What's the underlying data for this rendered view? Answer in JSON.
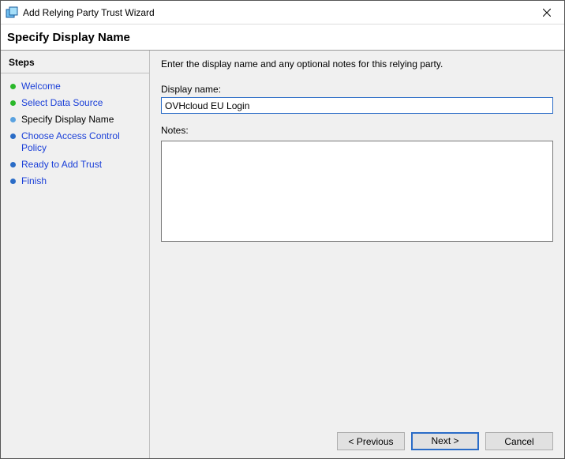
{
  "window": {
    "title": "Add Relying Party Trust Wizard"
  },
  "header": {
    "page_title": "Specify Display Name"
  },
  "sidebar": {
    "steps_header": "Steps",
    "items": [
      {
        "label": "Welcome",
        "state": "done"
      },
      {
        "label": "Select Data Source",
        "state": "done"
      },
      {
        "label": "Specify Display Name",
        "state": "current"
      },
      {
        "label": "Choose Access Control Policy",
        "state": "pending"
      },
      {
        "label": "Ready to Add Trust",
        "state": "pending"
      },
      {
        "label": "Finish",
        "state": "pending"
      }
    ]
  },
  "main": {
    "instruction": "Enter the display name and any optional notes for this relying party.",
    "display_name_label": "Display name:",
    "display_name_value": "OVHcloud EU Login",
    "notes_label": "Notes:",
    "notes_value": ""
  },
  "buttons": {
    "previous": "< Previous",
    "next": "Next >",
    "cancel": "Cancel"
  }
}
